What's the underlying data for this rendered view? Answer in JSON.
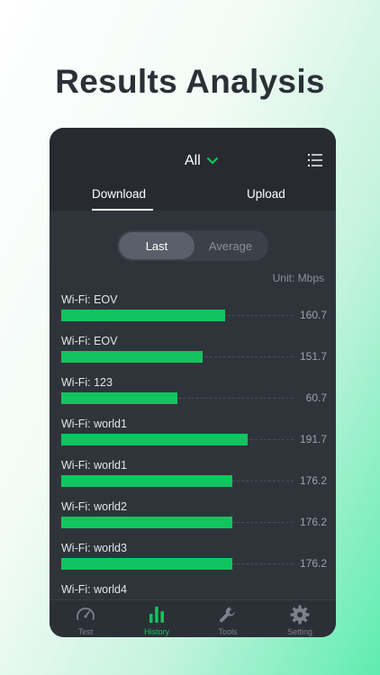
{
  "headline": "Results Analysis",
  "header": {
    "filter_label": "All",
    "tabs": [
      {
        "label": "Download",
        "active": true
      },
      {
        "label": "Upload",
        "active": false
      }
    ]
  },
  "segment": {
    "options": [
      {
        "label": "Last",
        "selected": true
      },
      {
        "label": "Average",
        "selected": false
      }
    ]
  },
  "unit_label": "Unit:  Mbps",
  "results": [
    {
      "label": "Wi-Fi: EOV",
      "value": "160.7"
    },
    {
      "label": "Wi-Fi: EOV",
      "value": "151.7"
    },
    {
      "label": "Wi-Fi: 123",
      "value": "60.7"
    },
    {
      "label": "Wi-Fi: world1",
      "value": "191.7"
    },
    {
      "label": "Wi-Fi: world1",
      "value": "176.2"
    },
    {
      "label": "Wi-Fi: world2",
      "value": "176.2"
    },
    {
      "label": "Wi-Fi: world3",
      "value": "176.2"
    },
    {
      "label": "Wi-Fi: world4",
      "value": ""
    }
  ],
  "tabbar": [
    {
      "label": "Test",
      "icon": "speedometer-icon",
      "active": false
    },
    {
      "label": "History",
      "icon": "bar-chart-icon",
      "active": true
    },
    {
      "label": "Tools",
      "icon": "wrench-icon",
      "active": false
    },
    {
      "label": "Setting",
      "icon": "gear-icon",
      "active": false
    }
  ],
  "colors": {
    "accent": "#12c45f",
    "panel": "#2f343b",
    "header": "#272b31"
  }
}
